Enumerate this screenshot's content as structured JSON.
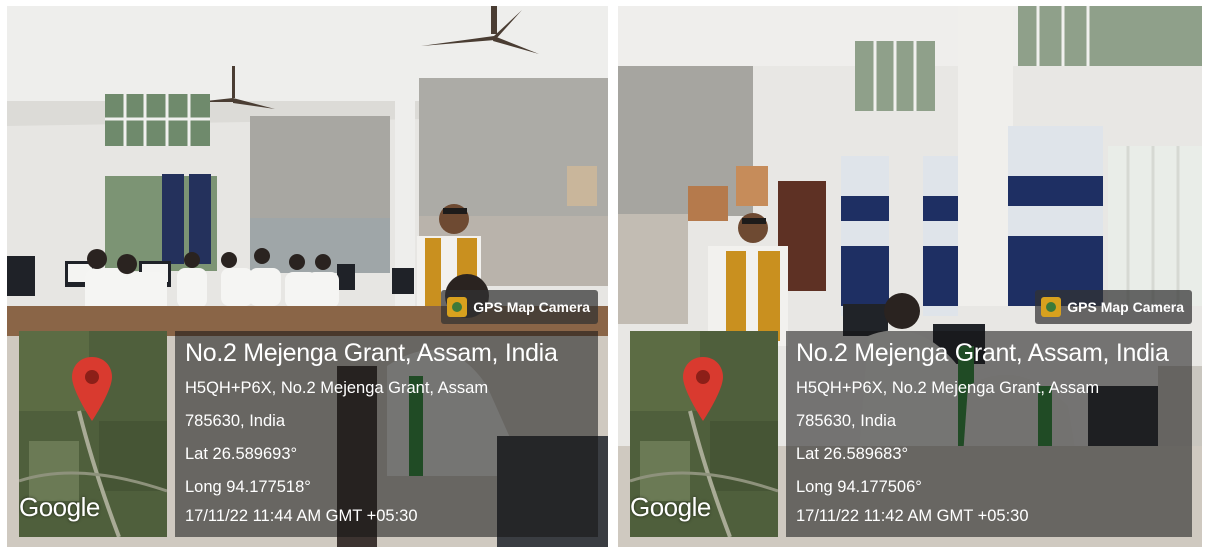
{
  "photos": [
    {
      "badge": "GPS Map Camera",
      "map_label": "Google",
      "place": "No.2 Mejenga Grant, Assam, India",
      "address_line1": "H5QH+P6X, No.2 Mejenga Grant, Assam",
      "address_line2": "785630, India",
      "lat": "Lat 26.589693°",
      "long": "Long 94.177518°",
      "datetime": "17/11/22 11:44 AM GMT +05:30"
    },
    {
      "badge": "GPS Map Camera",
      "map_label": "Google",
      "place": "No.2 Mejenga Grant, Assam, India",
      "address_line1": "H5QH+P6X, No.2 Mejenga Grant, Assam",
      "address_line2": "785630, India",
      "lat": "Lat 26.589683°",
      "long": "Long 94.177506°",
      "datetime": "17/11/22 11:42 AM GMT +05:30"
    }
  ],
  "colors": {
    "wall": "#e6e5e2",
    "blind": "#a9a8a3",
    "curtain_navy": "#1e2f63",
    "vest": "#c9901f",
    "pin": "#d93a2f",
    "panel": "#141414"
  },
  "icons": [
    "map-pin-icon",
    "gps-camera-icon"
  ]
}
